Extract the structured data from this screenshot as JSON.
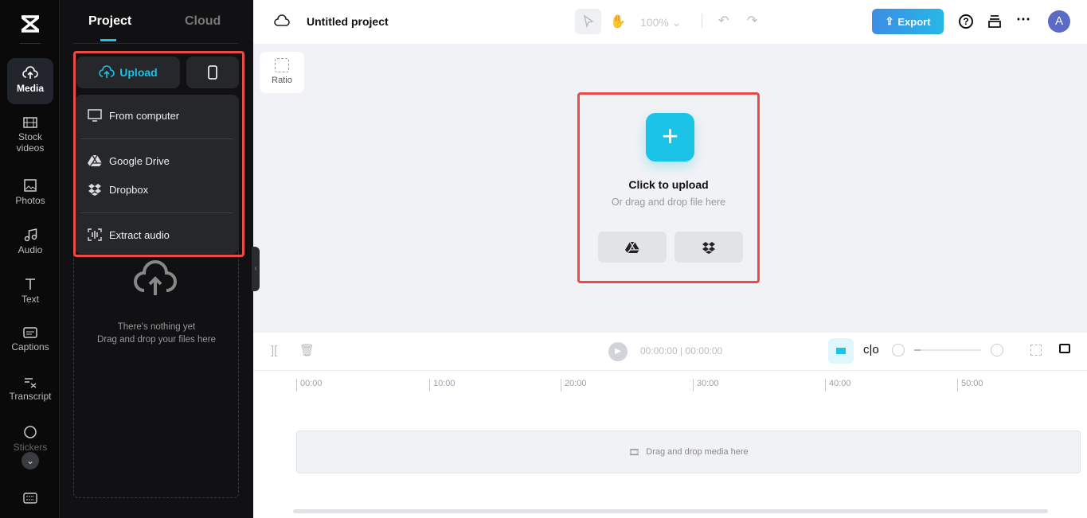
{
  "rail": {
    "items": [
      {
        "label": "Media"
      },
      {
        "label": "Stock videos"
      },
      {
        "label": "Photos"
      },
      {
        "label": "Audio"
      },
      {
        "label": "Text"
      },
      {
        "label": "Captions"
      },
      {
        "label": "Transcript"
      },
      {
        "label": "Stickers"
      }
    ]
  },
  "panel": {
    "tabs": [
      "Project",
      "Cloud"
    ],
    "upload_label": "Upload",
    "menu": [
      "From computer",
      "Google Drive",
      "Dropbox",
      "Extract audio"
    ],
    "empty_title": "There's nothing yet",
    "empty_sub": "Drag and drop your files here"
  },
  "header": {
    "title": "Untitled project",
    "zoom": "100%",
    "export_label": "Export",
    "avatar": "A"
  },
  "canvas": {
    "ratio_label": "Ratio",
    "upload_title": "Click to upload",
    "upload_sub": "Or drag and drop file here"
  },
  "timeline": {
    "current": "00:00:00",
    "total": "00:00:00",
    "ticks": [
      "00:00",
      "10:00",
      "20:00",
      "30:00",
      "40:00",
      "50:00"
    ],
    "drop_hint": "Drag and drop media here"
  },
  "colors": {
    "accent": "#1bc3e6",
    "export": "#3a8ee6",
    "highlight": "#e94a4a"
  }
}
